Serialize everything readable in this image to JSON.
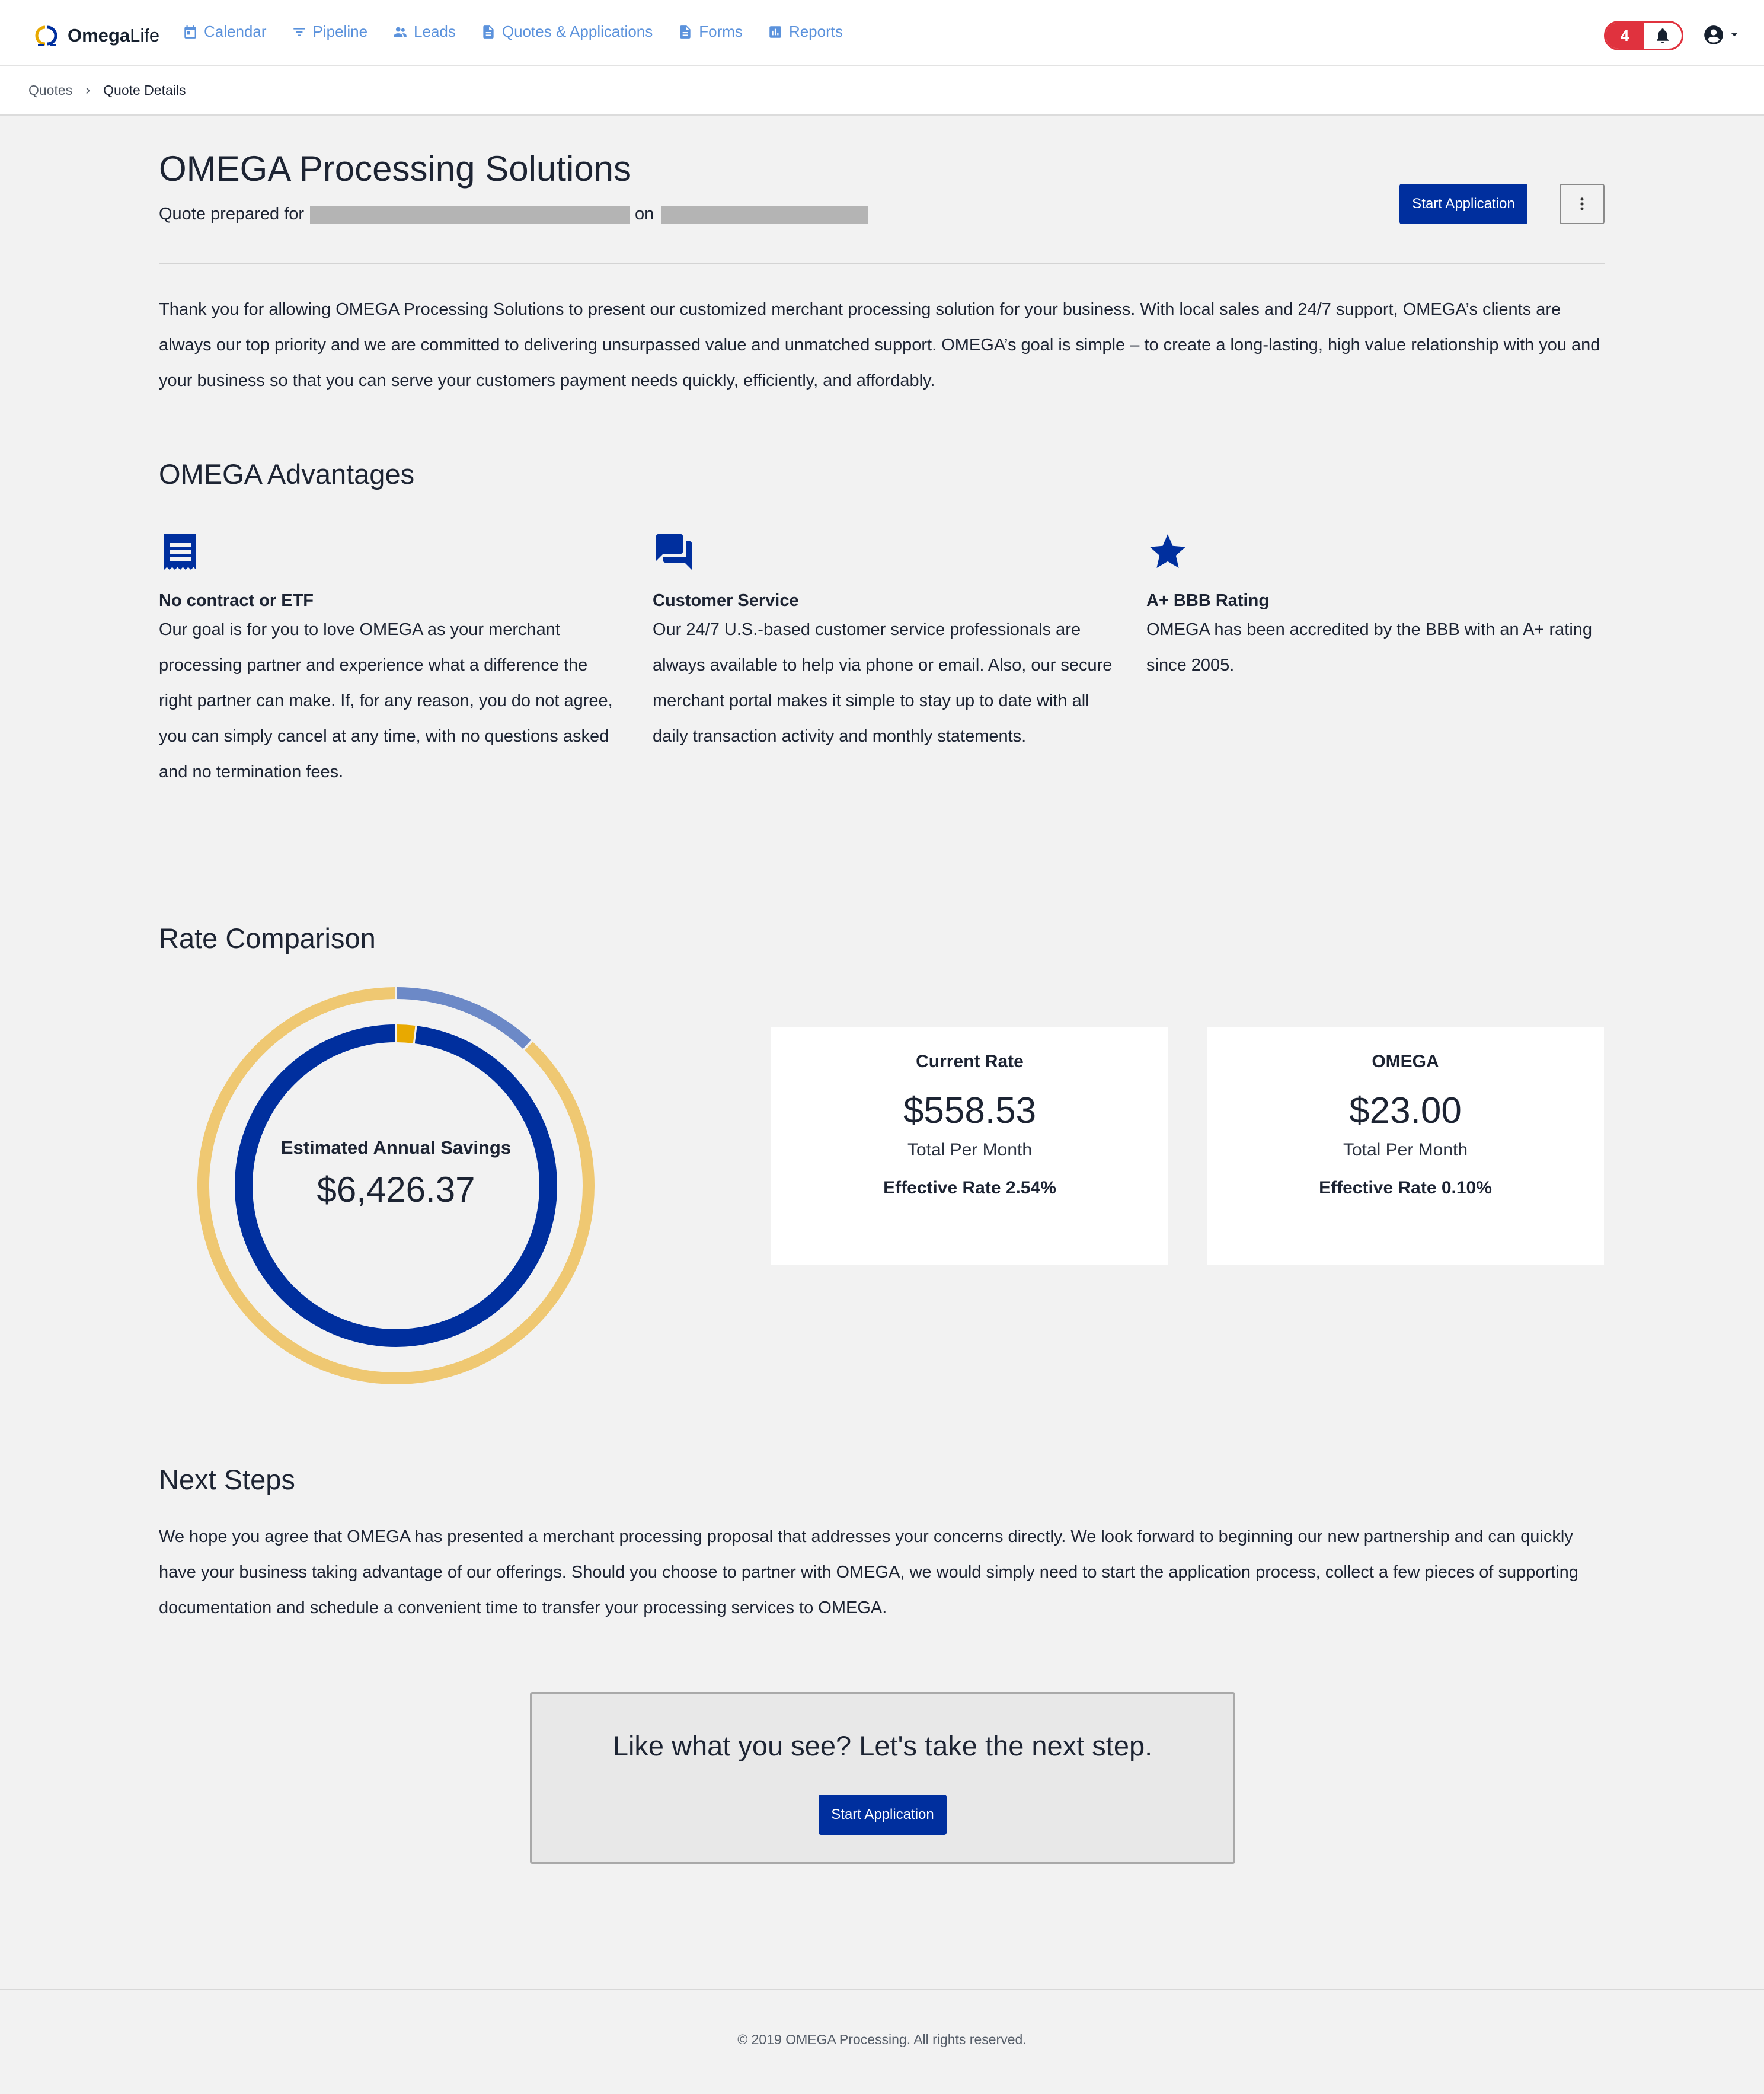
{
  "nav": {
    "logo_bold": "Omega",
    "logo_light": "Life",
    "items": [
      {
        "label": "Calendar",
        "icon": "calendar-icon"
      },
      {
        "label": "Pipeline",
        "icon": "filter-icon"
      },
      {
        "label": "Leads",
        "icon": "people-icon"
      },
      {
        "label": "Quotes & Applications",
        "icon": "document-icon"
      },
      {
        "label": "Forms",
        "icon": "document-icon"
      },
      {
        "label": "Reports",
        "icon": "bar-chart-icon"
      }
    ],
    "notification_count": "4",
    "accent_color": "#5b92dc"
  },
  "breadcrumb": {
    "items": [
      "Quotes",
      "Quote Details"
    ]
  },
  "header": {
    "title": "OMEGA Processing Solutions",
    "prepared_prefix": "Quote prepared for",
    "prepared_on": "on",
    "start_application_label": "Start Application"
  },
  "intro": "Thank you for allowing OMEGA Processing Solutions to present our customized merchant processing solution for your business. With local sales and 24/7 support, OMEGA’s clients are always our top priority and we are committed to delivering unsurpassed value and unmatched support. OMEGA’s goal is simple – to create a long-lasting, high value relationship with you and your business so that you can serve your customers payment needs quickly, efficiently, and affordably.",
  "advantages": {
    "title": "OMEGA Advantages",
    "items": [
      {
        "icon": "receipt-icon",
        "title": "No contract or ETF",
        "text": "Our goal is for you to love OMEGA as your merchant processing partner and experience what a difference the right partner can make. If, for any reason, you do not agree, you can simply cancel at any time, with no questions asked and no termination fees."
      },
      {
        "icon": "chat-icon",
        "title": "Customer Service",
        "text": "Our 24/7 U.S.-based customer service professionals are always available to help via phone or email. Also, our secure merchant portal makes it simple to stay up to date with all daily transaction activity and monthly statements."
      },
      {
        "icon": "star-icon",
        "title": "A+ BBB Rating",
        "text": "OMEGA has been accredited by the BBB with an A+ rating since 2005."
      }
    ]
  },
  "rate_comparison": {
    "title": "Rate Comparison",
    "savings_label": "Estimated Annual Savings",
    "savings_value": "$6,426.37",
    "cards": [
      {
        "heading": "Current Rate",
        "amount": "$558.53",
        "sub": "Total Per Month",
        "rate": "Effective Rate 2.54%"
      },
      {
        "heading": "OMEGA",
        "amount": "$23.00",
        "sub": "Total Per Month",
        "rate": "Effective Rate 0.10%"
      }
    ],
    "colors": {
      "outer_main": "#efc872",
      "outer_slice": "#6c89c7",
      "inner_main": "#002f9e",
      "inner_slice": "#e8a900"
    }
  },
  "chart_data": {
    "type": "pie",
    "title": "",
    "rings": [
      {
        "name": "",
        "values": [
          0.88,
          0.12
        ]
      },
      {
        "name": "",
        "values": [
          0.98,
          0.02
        ]
      }
    ]
  },
  "next_steps": {
    "title": "Next Steps",
    "text": "We hope you agree that OMEGA has presented a merchant processing proposal that addresses your concerns directly. We look forward to beginning our new partnership and can quickly have your business taking advantage of our offerings. Should you choose to partner with OMEGA, we would simply need to start the application process, collect a few pieces of supporting documentation and schedule a convenient time to transfer your processing services to OMEGA."
  },
  "cta": {
    "text": "Like what you see? Let's take the next step.",
    "button_label": "Start Application"
  },
  "footer": {
    "text": "© 2019 OMEGA Processing. All rights reserved."
  },
  "brand_color": "#002f9e"
}
